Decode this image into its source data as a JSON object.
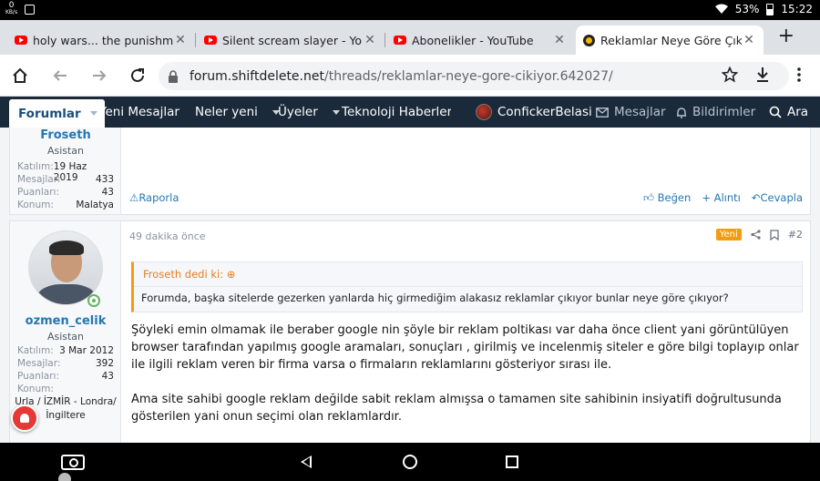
{
  "status": {
    "speed_value": "0",
    "speed_unit": "KB/s",
    "battery": "53%",
    "time": "15:22"
  },
  "tabs": [
    {
      "title": "holy wars... the punishment",
      "active": false,
      "favicon": "youtube-icon"
    },
    {
      "title": "Silent scream slayer - YouTu",
      "active": false,
      "favicon": "youtube-icon"
    },
    {
      "title": "Abonelikler - YouTube",
      "active": false,
      "favicon": "youtube-icon"
    },
    {
      "title": "Reklamlar Neye Göre Çıkıyor",
      "active": true,
      "favicon": "shiftdelete-icon"
    }
  ],
  "address": {
    "host": "forum.shiftdelete.net",
    "path": "/threads/reklamlar-neye-gore-cikiyor.642027/"
  },
  "forum_nav": {
    "forums": "Forumlar",
    "new_messages": "Yeni Mesajlar",
    "whats_new": "Neler yeni",
    "members": "Üyeler",
    "tech_news": "Teknoloji Haberleri",
    "username": "ConfickerBelasi",
    "inbox": "Mesajlar",
    "alerts": "Bildirimler",
    "search": "Ara"
  },
  "post1": {
    "user": "Froseth",
    "title": "Asistan",
    "stats": [
      {
        "k": "Katılım:",
        "v": "19 Haz 2019"
      },
      {
        "k": "Mesajlar:",
        "v": "433"
      },
      {
        "k": "Puanları:",
        "v": "43"
      },
      {
        "k": "Konum:",
        "v": "Malatya"
      }
    ],
    "report": "Raporla",
    "like": "Beğen",
    "quote": "+ Alıntı",
    "reply": "Cevapla"
  },
  "post2": {
    "user": "ozmen_celik",
    "title": "Asistan",
    "stats": [
      {
        "k": "Katılım:",
        "v": "3 Mar 2012"
      },
      {
        "k": "Mesajlar:",
        "v": "392"
      },
      {
        "k": "Puanları:",
        "v": "43"
      },
      {
        "k": "Konum:",
        "v": ""
      }
    ],
    "location_full": "Urla / İZMİR - Londra/ İngiltere",
    "time": "49 dakika önce",
    "new_badge": "Yeni",
    "post_no": "#2",
    "quote_header": "Froseth dedi ki:",
    "quote_body": "Forumda, başka sitelerde gezerken yanlarda hiç girmediğim alakasız reklamlar çıkıyor bunlar neye göre çıkıyor?",
    "para1": "Şöyleki emin olmamak ile beraber google nin şöyle bir reklam poltikası var daha önce client yani görüntülüyen browser tarafından yapılmış google aramaları, sonuçları , girilmiş ve incelenmiş siteler e göre bilgi toplayıp onlar ile ilgili reklam veren bir firma varsa o firmaların reklamlarını gösteriyor sırası ile.",
    "para2": "Ama site sahibi google reklam değilde sabit reklam almışsa o tamamen site sahibinin insiyatifi doğrultusunda gösterilen yani onun seçimi olan reklamlardır."
  },
  "colors": {
    "nav_bg": "#1a2a3a",
    "link": "#2577b1",
    "accent": "#f39c12"
  }
}
